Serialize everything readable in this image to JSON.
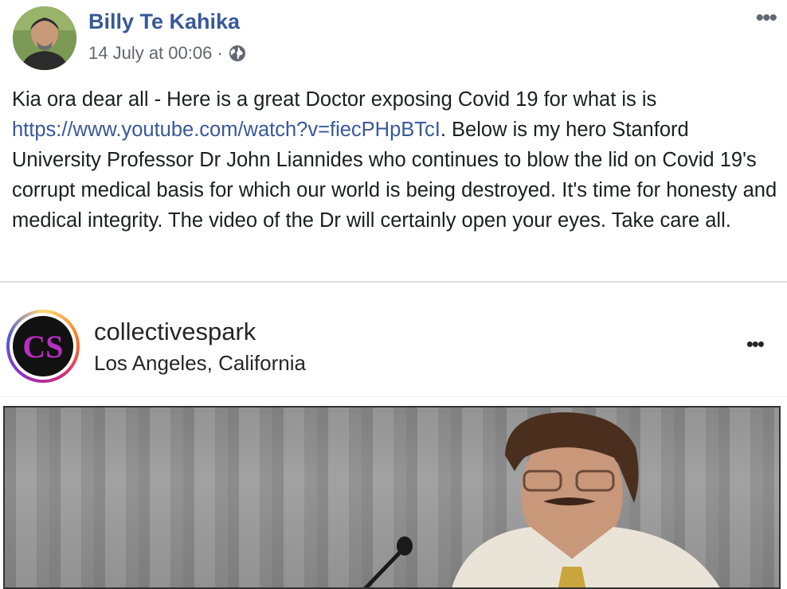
{
  "post": {
    "author": "Billy Te Kahika",
    "timestamp": "14 July at 00:06",
    "separator": "·",
    "privacy_icon": "globe-icon",
    "more_icon": "more-options-icon",
    "text_before_link": "Kia ora dear all - Here is a great Doctor exposing Covid 19 for what is is ",
    "link": "https://www.youtube.com/watch?v=fiecPHpBTcI",
    "text_after_link": ". Below is my hero Stanford University Professor Dr John Liannides who continues to blow the lid on Covid 19's corrupt medical basis for which our world is being destroyed. It's time for honesty and medical integrity. The video of the Dr will certainly open your eyes. Take care all."
  },
  "embed": {
    "username": "collectivespark",
    "location": "Los Angeles, California",
    "avatar_text": "CS",
    "more_icon": "more-options-icon"
  },
  "colors": {
    "link": "#385898",
    "author": "#385898",
    "meta": "#606770"
  }
}
